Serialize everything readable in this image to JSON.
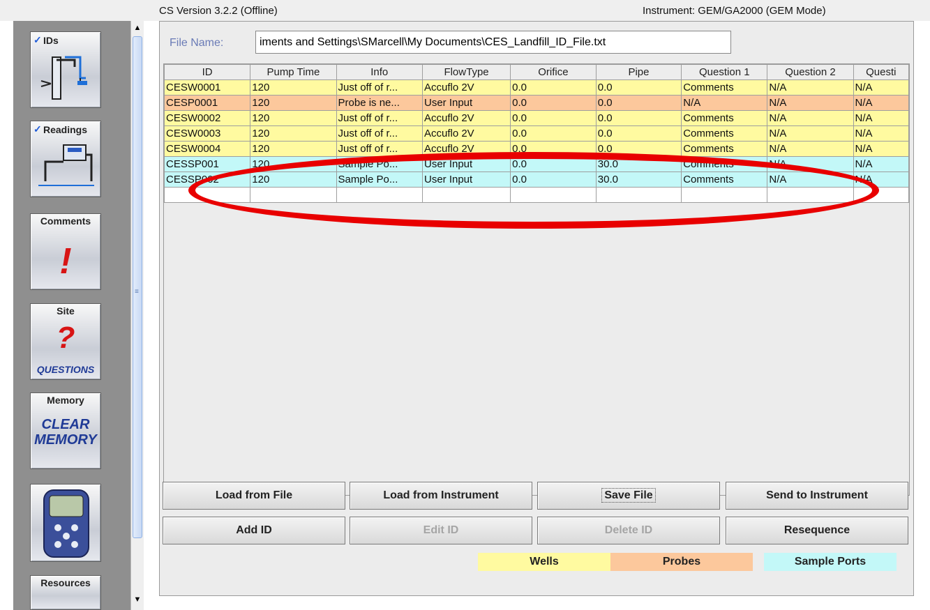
{
  "header": {
    "version": "CS Version 3.2.2 (Offline)",
    "instrument": "Instrument: GEM/GA2000 (GEM Mode)"
  },
  "toolbar": {
    "items": [
      {
        "label": "IDs",
        "icon": "pipe-diagram-icon"
      },
      {
        "label": "Readings",
        "icon": "monitor-diagram-icon"
      },
      {
        "label": "Comments",
        "icon": "exclamation-icon",
        "glyph": "!"
      },
      {
        "label": "Site",
        "icon": "question-icon",
        "glyph": "?",
        "subtext": "QUESTIONS"
      },
      {
        "label": "Memory",
        "icon": "clear-memory-icon",
        "line1": "CLEAR",
        "line2": "MEMORY"
      },
      {
        "label": "",
        "icon": "instrument-device-icon"
      },
      {
        "label": "Resources",
        "icon": "resources-icon"
      }
    ]
  },
  "file": {
    "label": "File Name:",
    "value": "iments and Settings\\SMarcell\\My Documents\\CES_Landfill_ID_File.txt"
  },
  "table": {
    "columns": [
      "ID",
      "Pump Time",
      "Info",
      "FlowType",
      "Orifice",
      "Pipe",
      "Question 1",
      "Question 2",
      "Questi"
    ],
    "rows": [
      {
        "type": "well",
        "cells": [
          "CESW0001",
          "120",
          "Just off of r...",
          "Accuflo 2V",
          "0.0",
          "0.0",
          "Comments",
          "N/A",
          "N/A"
        ]
      },
      {
        "type": "probe",
        "cells": [
          "CESP0001",
          "120",
          "Probe is ne...",
          "User Input",
          "0.0",
          "0.0",
          "N/A",
          "N/A",
          "N/A"
        ]
      },
      {
        "type": "well",
        "cells": [
          "CESW0002",
          "120",
          "Just off of r...",
          "Accuflo 2V",
          "0.0",
          "0.0",
          "Comments",
          "N/A",
          "N/A"
        ]
      },
      {
        "type": "well",
        "cells": [
          "CESW0003",
          "120",
          "Just off of r...",
          "Accuflo 2V",
          "0.0",
          "0.0",
          "Comments",
          "N/A",
          "N/A"
        ]
      },
      {
        "type": "well",
        "cells": [
          "CESW0004",
          "120",
          "Just off of r...",
          "Accuflo 2V",
          "0.0",
          "0.0",
          "Comments",
          "N/A",
          "N/A"
        ]
      },
      {
        "type": "port",
        "cells": [
          "CESSP001",
          "120",
          "Sample Po...",
          "User Input",
          "0.0",
          "30.0",
          "Comments",
          "N/A",
          "N/A"
        ]
      },
      {
        "type": "port",
        "cells": [
          "CESSP002",
          "120",
          "Sample Po...",
          "User Input",
          "0.0",
          "30.0",
          "Comments",
          "N/A",
          "N/A"
        ]
      }
    ]
  },
  "buttons": {
    "load_file": "Load from File",
    "load_instrument": "Load from Instrument",
    "save_file": "Save File",
    "send_instrument": "Send to Instrument",
    "add_id": "Add ID",
    "edit_id": "Edit ID",
    "delete_id": "Delete ID",
    "resequence": "Resequence"
  },
  "legend": {
    "wells": "Wells",
    "probes": "Probes",
    "sample_ports": "Sample Ports"
  },
  "colors": {
    "well": "#fffaa0",
    "probe": "#fcc89c",
    "port": "#c3f8f8",
    "annotation": "#e80000"
  }
}
